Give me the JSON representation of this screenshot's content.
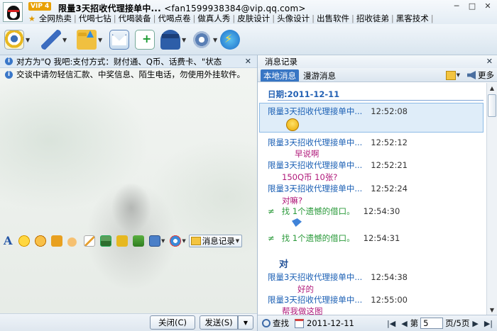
{
  "window": {
    "title": "限量3天招收代理接单中...",
    "email": "<fan1599938384@vip.qq.com>",
    "vip_label": "VIP 4",
    "controls": {
      "minimize": "─",
      "maximize": "□",
      "close": "✕"
    }
  },
  "nav_links": [
    "全网热卖",
    "代喝七钻",
    "代喝装备",
    "代喝点卷",
    "做真人秀",
    "皮肤设计",
    "头像设计",
    "出售软件",
    "招收徒弟",
    "黑客技术"
  ],
  "notices": {
    "line1": "对方为\"Q 我吧:支付方式：财付通、Q币、话费卡、\"状态",
    "line2": "交谈中请勿轻信汇款、中奖信息、陌生电话，勿使用外挂软件。"
  },
  "format_toolbar": {
    "font_glyph": "A",
    "msglog_label": "消息记录"
  },
  "buttons": {
    "close": "关闭(C)",
    "send": "发送(S)"
  },
  "history": {
    "panel_title": "消息记录",
    "tab_local": "本地消息",
    "tab_roam": "漫游消息",
    "more_label": "更多",
    "date_label": "日期:2011-12-11",
    "messages": [
      {
        "sender": "限量3天招收代理接单中...",
        "time": "12:52:08",
        "text": ""
      },
      {
        "sender": "限量3天招收代理接单中...",
        "time": "12:52:12",
        "text": "早说啊"
      },
      {
        "sender": "限量3天招收代理接单中...",
        "time": "12:52:21",
        "text": "150Q币   10张?"
      },
      {
        "sender": "限量3天招收代理接单中...",
        "time": "12:52:24",
        "text": "对嘛?"
      },
      {
        "sender": "找 1个遗憾的借口。",
        "time": "12:54:30",
        "text": ""
      },
      {
        "sender": "找 1个遗憾的借口。",
        "time": "12:54:31",
        "text": "对"
      },
      {
        "sender": "限量3天招收代理接单中...",
        "time": "12:54:38",
        "text": "好的"
      },
      {
        "sender": "限量3天招收代理接单中...",
        "time": "12:55:00",
        "text": "帮我做这图"
      }
    ],
    "approx_symbol": "≠",
    "find_label": "查找",
    "footer_date": "2011-12-11",
    "page_prefix": "第",
    "page_value": "5",
    "page_suffix": "页/5页"
  },
  "colors": {
    "accent": "#3876c4",
    "sender_blue": "#1a5fb4",
    "peer_green": "#2a9a3a",
    "msg_magenta": "#b0197a"
  }
}
